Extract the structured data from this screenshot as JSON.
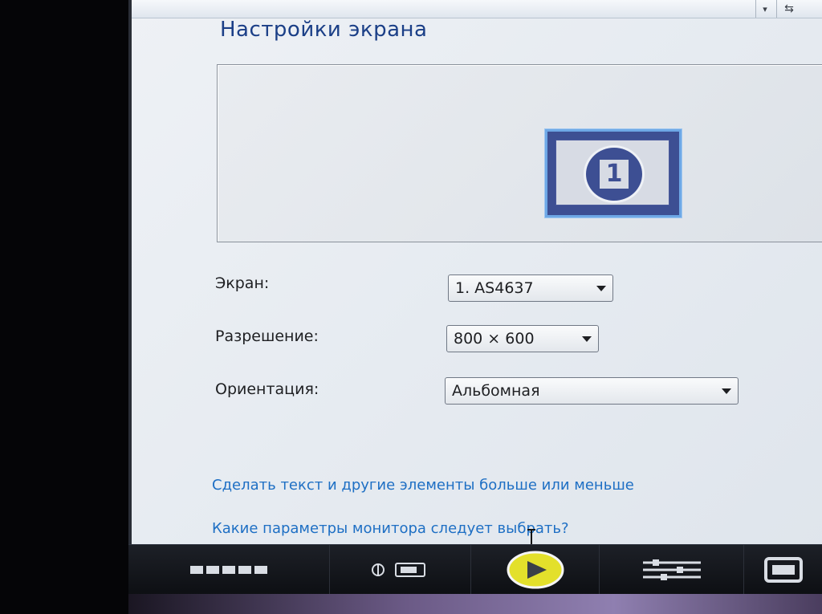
{
  "window": {
    "title": "Настройки экрана"
  },
  "preview": {
    "monitor_number": "1"
  },
  "settings": {
    "display": {
      "label": "Экран:",
      "value": "1. AS4637"
    },
    "resolution": {
      "label": "Разрешение:",
      "value": "800 × 600"
    },
    "orientation": {
      "label": "Ориентация:",
      "value": "Альбомная"
    }
  },
  "links": {
    "text_size": "Сделать текст и другие элементы больше или меньше",
    "which_settings": "Какие параметры монитора следует выбрать?"
  },
  "colors": {
    "title": "#1b3f87",
    "link": "#1e6fc4",
    "monitor_tile": "#3d4f93",
    "selection_border": "#6ea8e6"
  },
  "icons": {
    "taskbar": [
      "apps-grid-icon",
      "network-usb-icon",
      "media-player-icon",
      "mixer-icon",
      "window-icon"
    ]
  }
}
